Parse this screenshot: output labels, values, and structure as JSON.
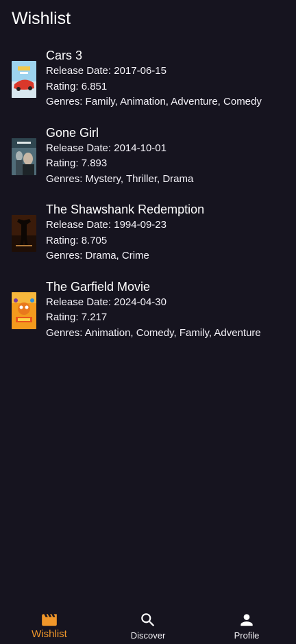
{
  "header": {
    "title": "Wishlist"
  },
  "labels": {
    "release": "Release Date: ",
    "rating": "Rating: ",
    "genres": "Genres: "
  },
  "movies": [
    {
      "title": "Cars 3",
      "release_date": "2017-06-15",
      "rating": "6.851",
      "genres": "Family, Animation, Adventure, Comedy",
      "poster_colors": [
        "#8fc7e6",
        "#d9382b",
        "#f2c94c"
      ]
    },
    {
      "title": "Gone Girl",
      "release_date": "2014-10-01",
      "rating": "7.893",
      "genres": "Mystery, Thriller, Drama",
      "poster_colors": [
        "#4a6a78",
        "#202a30",
        "#b7c4c6"
      ]
    },
    {
      "title": "The Shawshank Redemption",
      "release_date": "1994-09-23",
      "rating": "8.705",
      "genres": "Drama, Crime",
      "poster_colors": [
        "#2a1408",
        "#6b3a18",
        "#d9a45a"
      ]
    },
    {
      "title": "The Garfield Movie",
      "release_date": "2024-04-30",
      "rating": "7.217",
      "genres": "Animation, Comedy, Family, Adventure",
      "poster_colors": [
        "#f39a1d",
        "#e9541c",
        "#ffd54a"
      ]
    }
  ],
  "bottom_nav": {
    "items": [
      {
        "label": "Wishlist",
        "icon": "movie-clapper-icon",
        "active": true
      },
      {
        "label": "Discover",
        "icon": "search-icon",
        "active": false
      },
      {
        "label": "Profile",
        "icon": "person-icon",
        "active": false
      }
    ],
    "active_color": "#f0972a",
    "inactive_color": "#f1f0f4"
  },
  "colors": {
    "background": "#16141f",
    "text": "#ffffff"
  }
}
